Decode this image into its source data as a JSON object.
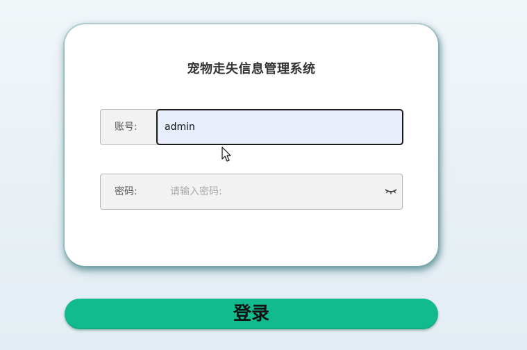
{
  "app": {
    "title": "宠物走失信息管理系统"
  },
  "form": {
    "username": {
      "label": "账号:",
      "value": "admin"
    },
    "password": {
      "label": "密码:",
      "value": "",
      "placeholder": "请输入密码:",
      "toggle_icon": "eye-closed-icon"
    },
    "submit_label": "登录"
  },
  "colors": {
    "accent": "#12bb8d",
    "card_shadow": "#5d9ea3",
    "input_focus_bg": "#e8eefc"
  }
}
